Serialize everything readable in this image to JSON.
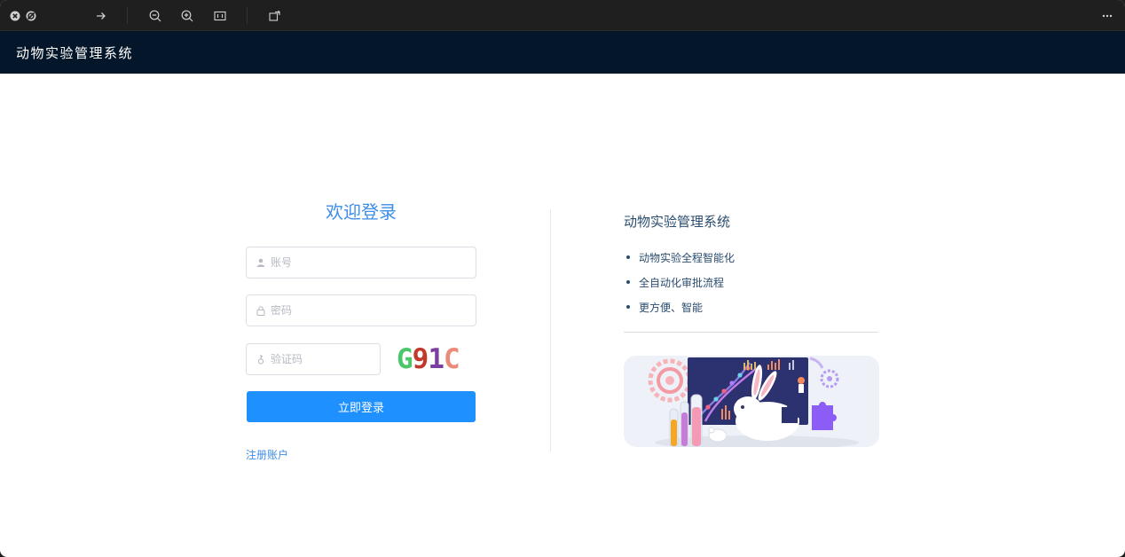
{
  "app": {
    "title": "动物实验管理系统"
  },
  "login": {
    "welcome": "欢迎登录",
    "account_placeholder": "账号",
    "password_placeholder": "密码",
    "captcha_placeholder": "验证码",
    "captcha_chars": [
      {
        "char": "G",
        "color": "#4cc56b"
      },
      {
        "char": "9",
        "color": "#c0392b"
      },
      {
        "char": "1",
        "color": "#7b3fa0"
      },
      {
        "char": "C",
        "color": "#ec8a7a"
      }
    ],
    "login_button": "立即登录",
    "register_link": "注册账户"
  },
  "info": {
    "title": "动物实验管理系统",
    "features": [
      "动物实验全程智能化",
      "全自动化审批流程",
      "更方便、智能"
    ]
  },
  "icons": {
    "viewer": [
      "close-icon",
      "stop-icon",
      "forward-arrow-icon",
      "zoom-out-icon",
      "zoom-in-icon",
      "fit-icon",
      "rotate-icon",
      "more-icon"
    ],
    "fields": [
      "user-icon",
      "lock-icon",
      "key-icon"
    ]
  },
  "colors": {
    "header_bg": "#041629",
    "accent": "#1e90ff",
    "welcome": "#3d8ee9",
    "info_text": "#2a4c6e"
  }
}
